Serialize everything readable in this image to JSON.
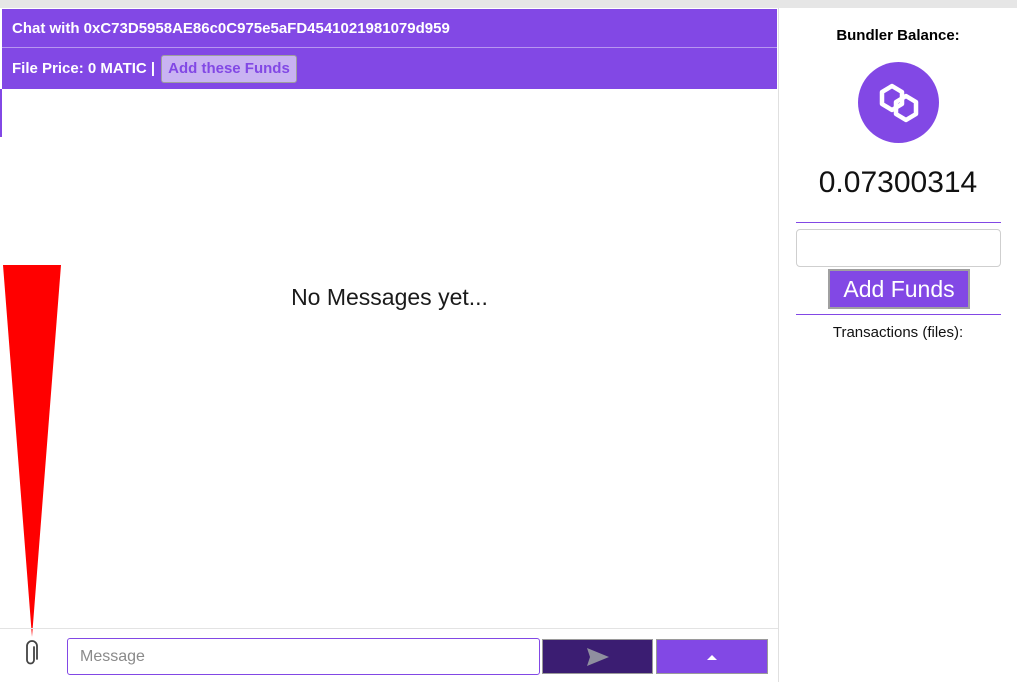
{
  "chat": {
    "title": "Chat with 0xC73D5958AE86c0C975e5aFD4541021981079d959",
    "file_price_label": "File Price: 0 MATIC |",
    "add_these_funds_label": "Add these Funds",
    "empty_state": "No Messages yet...",
    "message_placeholder": "Message",
    "attach_icon": "paperclip-icon",
    "send_icon": "send-icon",
    "expand_icon": "caret-up-icon"
  },
  "sidebar": {
    "balance_title": "Bundler Balance:",
    "balance_value": "0.07300314",
    "logo_icon": "polygon-matic-icon",
    "add_funds_label": "Add Funds",
    "transactions_label": "Transactions (files):"
  },
  "colors": {
    "accent": "#8248e5",
    "send_button": "#3b1d72",
    "annotation_arrow": "#ff0000"
  }
}
